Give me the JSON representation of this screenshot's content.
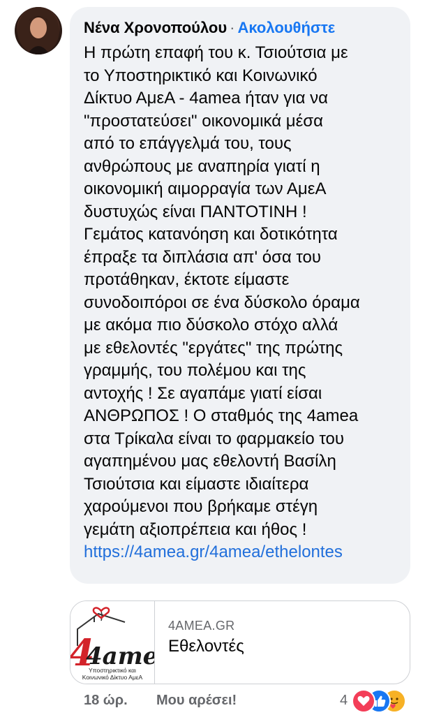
{
  "comment": {
    "author": "Νένα Χρονοπούλου",
    "separator": "·",
    "follow_label": "Ακολουθήστε",
    "lines": [
      "Η πρώτη επαφή του κ. Τσιούτσια με",
      "το Υποστηρικτικό και Κοινωνικό",
      "Δίκτυο ΑμεΑ - 4amea ήταν για να",
      "\"προστατεύσει\" οικονομικά μέσα",
      "από το επάγγελμά του, τους",
      "ανθρώπους με αναπηρία γιατί η",
      "οικονομική αιμορραγία των ΑμεΑ",
      "δυστυχώς είναι ΠΑΝΤΟΤΙΝΗ !",
      "Γεμάτος κατανόηση και δοτικότητα",
      "έπραξε τα διπλάσια απ' όσα του",
      "προτάθηκαν, έκτοτε είμαστε",
      "συνοδοιπόροι σε ένα δύσκολο όραμα",
      "με ακόμα πιο δύσκολο στόχο αλλά",
      "με εθελοντές \"εργάτες\" της πρώτης",
      "γραμμής, του πολέμου και της",
      "αντοχής ! Σε αγαπάμε γιατί είσαι",
      "ΑΝΘΡΩΠΟΣ ! Ο σταθμός της 4amea",
      "στα Τρίκαλα είναι το φαρμακείο του",
      "αγαπημένου μας εθελοντή Βασίλη",
      "Τσιούτσια και είμαστε ιδιαίτερα",
      "χαρούμενοι που βρήκαμε στέγη",
      "γεμάτη αξιοπρέπεια και ήθος !"
    ],
    "link": "https://4amea.gr/4amea/ethelontes"
  },
  "link_preview": {
    "logo_text": "4amea",
    "logo_subtitle_1": "Υποστηρικτικό και",
    "logo_subtitle_2": "Κοινωνικό Δίκτυο ΑμεΑ",
    "domain": "4AMEA.GR",
    "title": "Εθελοντές"
  },
  "footer": {
    "time": "18 ώρ.",
    "like_label": "Μου αρέσει!",
    "reaction_count": "4"
  },
  "reactions": [
    "love-icon",
    "like-icon",
    "care-icon"
  ],
  "colors": {
    "bubble": "#f0f2f5",
    "link": "#216fdb",
    "follow": "#1877f2",
    "love": "#f33e58",
    "like": "#1877f2",
    "care": "#f7b125"
  }
}
